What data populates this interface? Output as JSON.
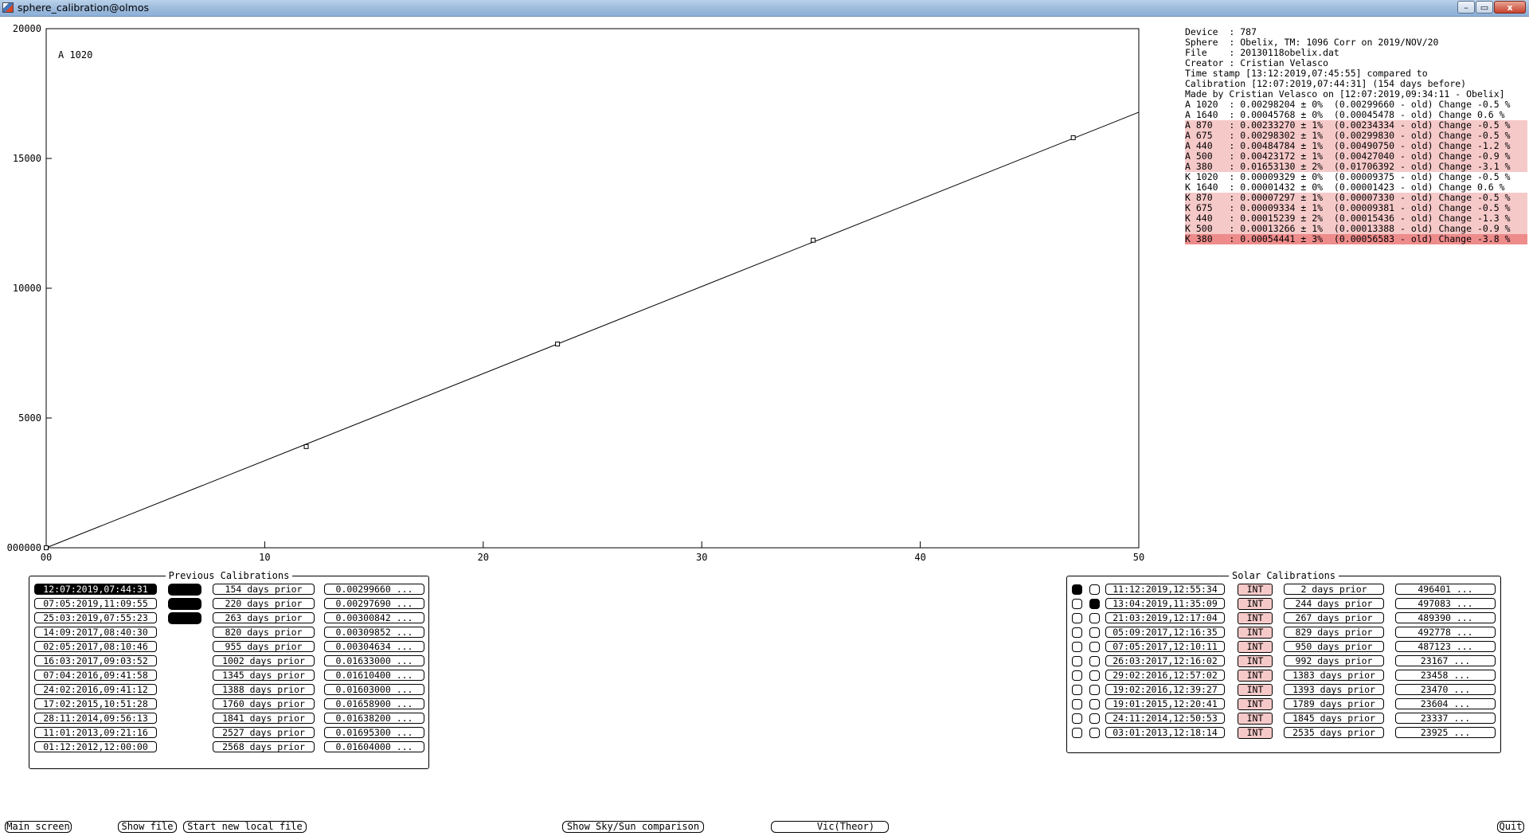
{
  "window": {
    "title": "sphere_calibration@olmos",
    "min": "–",
    "max": "▭",
    "close": "x"
  },
  "chart_data": {
    "type": "scatter",
    "title": "",
    "label": "A 1020",
    "xlim": [
      0,
      50
    ],
    "ylim": [
      0,
      20000
    ],
    "xticks": [
      "00",
      "10",
      "20",
      "30",
      "40",
      "50"
    ],
    "yticks": [
      "000000",
      "5000",
      "10000",
      "15000",
      "20000"
    ],
    "points": [
      [
        0,
        0
      ],
      [
        11.9,
        3900
      ],
      [
        23.4,
        7850
      ],
      [
        35.1,
        11850
      ],
      [
        47.0,
        15800
      ]
    ],
    "fit_line": [
      [
        0,
        0
      ],
      [
        50,
        16780
      ]
    ]
  },
  "info": {
    "lines": [
      "Device  : 787",
      "Sphere  : Obelix, TM: 1096 Corr on 2019/NOV/20",
      "File    : 20130118obelix.dat",
      "Creator : Cristian Velasco",
      "Time stamp [13:12:2019,07:45:55] compared to",
      "Calibration [12:07:2019,07:44:31] (154 days before)",
      "Made by Cristian Velasco on [12:07:2019,09:34:11 - Obelix]"
    ],
    "calibs": [
      {
        "text": "A 1020  : 0.00298204 ± 0%  (0.00299660 - old) Change -0.5 %",
        "hl": "none"
      },
      {
        "text": "A 1640  : 0.00045768 ± 0%  (0.00045478 - old) Change 0.6 %",
        "hl": "none"
      },
      {
        "text": "A 870   : 0.00233270 ± 1%  (0.00234334 - old) Change -0.5 %",
        "hl": "pink"
      },
      {
        "text": "A 675   : 0.00298302 ± 1%  (0.00299830 - old) Change -0.5 %",
        "hl": "pink"
      },
      {
        "text": "A 440   : 0.00484784 ± 1%  (0.00490750 - old) Change -1.2 %",
        "hl": "pink"
      },
      {
        "text": "A 500   : 0.00423172 ± 1%  (0.00427040 - old) Change -0.9 %",
        "hl": "pink"
      },
      {
        "text": "A 380   : 0.01653130 ± 2%  (0.01706392 - old) Change -3.1 %",
        "hl": "pink"
      },
      {
        "text": "K 1020  : 0.00009329 ± 0%  (0.00009375 - old) Change -0.5 %",
        "hl": "none"
      },
      {
        "text": "K 1640  : 0.00001432 ± 0%  (0.00001423 - old) Change 0.6 %",
        "hl": "none"
      },
      {
        "text": "K 870   : 0.00007297 ± 1%  (0.00007330 - old) Change -0.5 %",
        "hl": "pink"
      },
      {
        "text": "K 675   : 0.00009334 ± 1%  (0.00009381 - old) Change -0.5 %",
        "hl": "pink"
      },
      {
        "text": "K 440   : 0.00015239 ± 2%  (0.00015436 - old) Change -1.3 %",
        "hl": "pink"
      },
      {
        "text": "K 500   : 0.00013266 ± 1%  (0.00013388 - old) Change -0.9 %",
        "hl": "pink"
      },
      {
        "text": "K 380   : 0.00054441 ± 3%  (0.00056583 - old) Change -3.8 %",
        "hl": "red"
      }
    ]
  },
  "previous": {
    "legend": "Previous Calibrations",
    "rows": [
      {
        "date": "12:07:2019,07:44:31",
        "selected": true,
        "marker": true,
        "prior": "154 days prior",
        "value": "0.00299660 ..."
      },
      {
        "date": "07:05:2019,11:09:55",
        "selected": false,
        "marker": true,
        "prior": "220 days prior",
        "value": "0.00297690 ..."
      },
      {
        "date": "25:03:2019,07:55:23",
        "selected": false,
        "marker": true,
        "prior": "263 days prior",
        "value": "0.00300842 ..."
      },
      {
        "date": "14:09:2017,08:40:30",
        "selected": false,
        "marker": false,
        "prior": "820 days prior",
        "value": "0.00309852 ..."
      },
      {
        "date": "02:05:2017,08:10:46",
        "selected": false,
        "marker": false,
        "prior": "955 days prior",
        "value": "0.00304634 ..."
      },
      {
        "date": "16:03:2017,09:03:52",
        "selected": false,
        "marker": false,
        "prior": "1002 days prior",
        "value": "0.01633000 ..."
      },
      {
        "date": "07:04:2016,09:41:58",
        "selected": false,
        "marker": false,
        "prior": "1345 days prior",
        "value": "0.01610400 ..."
      },
      {
        "date": "24:02:2016,09:41:12",
        "selected": false,
        "marker": false,
        "prior": "1388 days prior",
        "value": "0.01603000 ..."
      },
      {
        "date": "17:02:2015,10:51:28",
        "selected": false,
        "marker": false,
        "prior": "1760 days prior",
        "value": "0.01658900 ..."
      },
      {
        "date": "28:11:2014,09:56:13",
        "selected": false,
        "marker": false,
        "prior": "1841 days prior",
        "value": "0.01638200 ..."
      },
      {
        "date": "11:01:2013,09:21:16",
        "selected": false,
        "marker": false,
        "prior": "2527 days prior",
        "value": "0.01695300 ..."
      },
      {
        "date": "01:12:2012,12:00:00",
        "selected": false,
        "marker": false,
        "prior": "2568 days prior",
        "value": "0.01604000 ..."
      }
    ]
  },
  "solar": {
    "legend": "Solar Calibrations",
    "rows": [
      {
        "c1": true,
        "c2": false,
        "date": "11:12:2019,12:55:34",
        "int": "INT",
        "prior": "2 days prior",
        "value": "496401 ..."
      },
      {
        "c1": false,
        "c2": true,
        "date": "13:04:2019,11:35:09",
        "int": "INT",
        "prior": "244 days prior",
        "value": "497083 ..."
      },
      {
        "c1": false,
        "c2": false,
        "date": "21:03:2019,12:17:04",
        "int": "INT",
        "prior": "267 days prior",
        "value": "489390 ..."
      },
      {
        "c1": false,
        "c2": false,
        "date": "05:09:2017,12:16:35",
        "int": "INT",
        "prior": "829 days prior",
        "value": "492778 ..."
      },
      {
        "c1": false,
        "c2": false,
        "date": "07:05:2017,12:10:11",
        "int": "INT",
        "prior": "950 days prior",
        "value": "487123 ..."
      },
      {
        "c1": false,
        "c2": false,
        "date": "26:03:2017,12:16:02",
        "int": "INT",
        "prior": "992 days prior",
        "value": "23167 ..."
      },
      {
        "c1": false,
        "c2": false,
        "date": "29:02:2016,12:57:02",
        "int": "INT",
        "prior": "1383 days prior",
        "value": "23458 ..."
      },
      {
        "c1": false,
        "c2": false,
        "date": "19:02:2016,12:39:27",
        "int": "INT",
        "prior": "1393 days prior",
        "value": "23470 ..."
      },
      {
        "c1": false,
        "c2": false,
        "date": "19:01:2015,12:20:41",
        "int": "INT",
        "prior": "1789 days prior",
        "value": "23604 ..."
      },
      {
        "c1": false,
        "c2": false,
        "date": "24:11:2014,12:50:53",
        "int": "INT",
        "prior": "1845 days prior",
        "value": "23337 ..."
      },
      {
        "c1": false,
        "c2": false,
        "date": "03:01:2013,12:18:14",
        "int": "INT",
        "prior": "2535 days prior",
        "value": "23925 ..."
      }
    ]
  },
  "bottom": {
    "main": "Main screen",
    "show_file": "Show file",
    "start_new": "Start new local file",
    "sky_sun": "Show Sky/Sun comparison",
    "vic": "Vic(Theor)",
    "quit": "Quit"
  }
}
